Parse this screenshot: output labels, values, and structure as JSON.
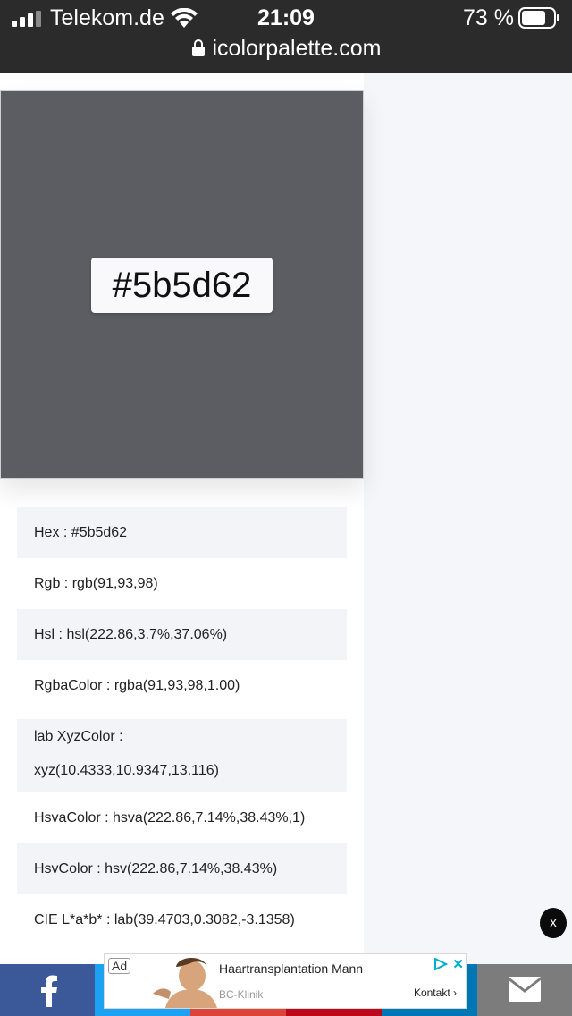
{
  "status_bar": {
    "carrier": "Telekom.de",
    "time": "21:09",
    "battery_percent": "73 %",
    "url": "icolorpalette.com"
  },
  "swatch": {
    "color": "#5b5d62",
    "hex_label": "#5b5d62"
  },
  "info": {
    "hex": "Hex : #5b5d62",
    "rgb": "Rgb : rgb(91,93,98)",
    "hsl": "Hsl : hsl(222.86,3.7%,37.06%)",
    "rgba": "RgbaColor : rgba(91,93,98,1.00)",
    "xyz_line1": "lab XyzColor :",
    "xyz_line2": "xyz(10.4333,10.9347,13.116)",
    "hsva": "HsvaColor : hsva(222.86,7.14%,38.43%,1)",
    "hsv": "HsvColor : hsv(222.86,7.14%,38.43%)",
    "lab": "CIE L*a*b* : lab(39.4703,0.3082,-3.1358)"
  },
  "close_label": "x",
  "ad": {
    "label": "Ad",
    "title": "Haartransplantation Mann",
    "sponsor": "BC-Klinik",
    "cta": "Kontakt",
    "close": "✕"
  },
  "share_buttons": [
    "facebook-icon",
    "twitter-icon",
    "google-plus-icon",
    "pinterest-icon",
    "linkedin-icon",
    "email-icon"
  ],
  "colors": {
    "facebook": "#3b5998",
    "twitter": "#1da1f2",
    "google_plus": "#db4437",
    "pinterest": "#bd081c",
    "linkedin": "#0077b5",
    "email": "#7c7c7c"
  }
}
